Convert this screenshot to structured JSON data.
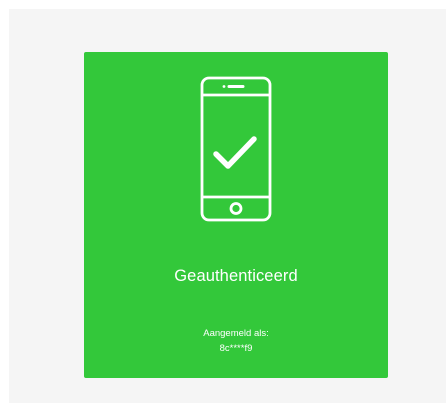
{
  "card": {
    "title": "Geauthenticeerd",
    "login_label": "Aangemeld als:",
    "login_id": "8c****f9",
    "icon": "phone-check-icon",
    "background_color": "#33c83a",
    "text_color": "#ffffff"
  },
  "page": {
    "background_color": "#f5f5f5"
  }
}
